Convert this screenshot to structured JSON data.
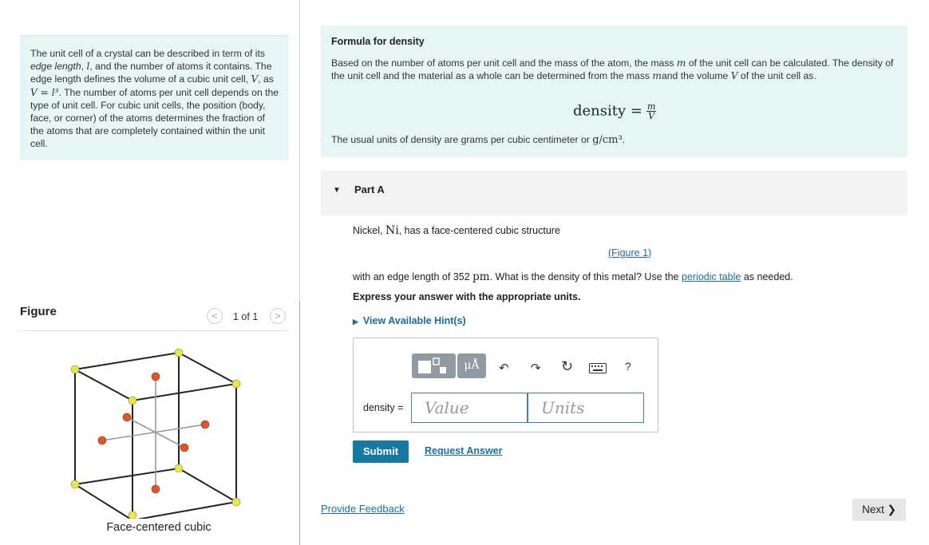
{
  "intro": {
    "p1": "The unit cell of a crystal can be described in term of its",
    "edge_length_em": "edge length",
    "p2": ",",
    "l_sym": "l",
    "p3": ", and the number of atoms it contains. The edge length defines the volume of a cubic unit cell,",
    "V_sym": "V",
    "p4": ", as",
    "formula": "V = l³",
    "p5": ". The number of atoms per unit cell depends on the type of unit cell. For cubic unit cells, the position (body, face, or corner) of the atoms determines the fraction of the atoms that are completely contained within the unit cell."
  },
  "figure": {
    "title": "Figure",
    "prev": "<",
    "count": "1 of 1",
    "next": ">",
    "caption": "Face-centered cubic"
  },
  "formula_box": {
    "title": "Formula for density",
    "t1": "Based on the number of atoms per unit cell and the mass of the atom, the mass",
    "m1": "m",
    "t2": "of the unit cell can be calculated. The density of the unit cell and the material as a whole can be determined from the mass",
    "m2": "m",
    "t3": "and the volume",
    "v": "V",
    "t4": "of the unit cell as.",
    "eq_lhs": "density =",
    "eq_num": "m",
    "eq_den": "V",
    "units_text": "The usual units of density are grams per cubic centimeter or",
    "units_math": "g/cm³",
    "units_end": "."
  },
  "partA": {
    "label": "Part A",
    "q1a": "Nickel,",
    "q1ni": "Ni",
    "q1b": ", has a face-centered cubic structure",
    "figure_link": "(Figure 1)",
    "q2a": "with an edge length of 352",
    "q2pm": "pm",
    "q2b": ". What is the density of this metal? Use the",
    "periodic_link": "periodic table",
    "q2c": "as needed.",
    "instruction": "Express your answer with the appropriate units.",
    "hint": "View Available Hint(s)"
  },
  "answer": {
    "label": "density =",
    "value_placeholder": "Value",
    "units_placeholder": "Units",
    "tool_undo": "↶",
    "tool_redo": "↷",
    "tool_reset": "↻",
    "tool_help": "?",
    "tool_mu": "μÅ",
    "submit": "Submit",
    "request": "Request Answer"
  },
  "footer": {
    "feedback": "Provide Feedback",
    "next": "Next ❯"
  }
}
